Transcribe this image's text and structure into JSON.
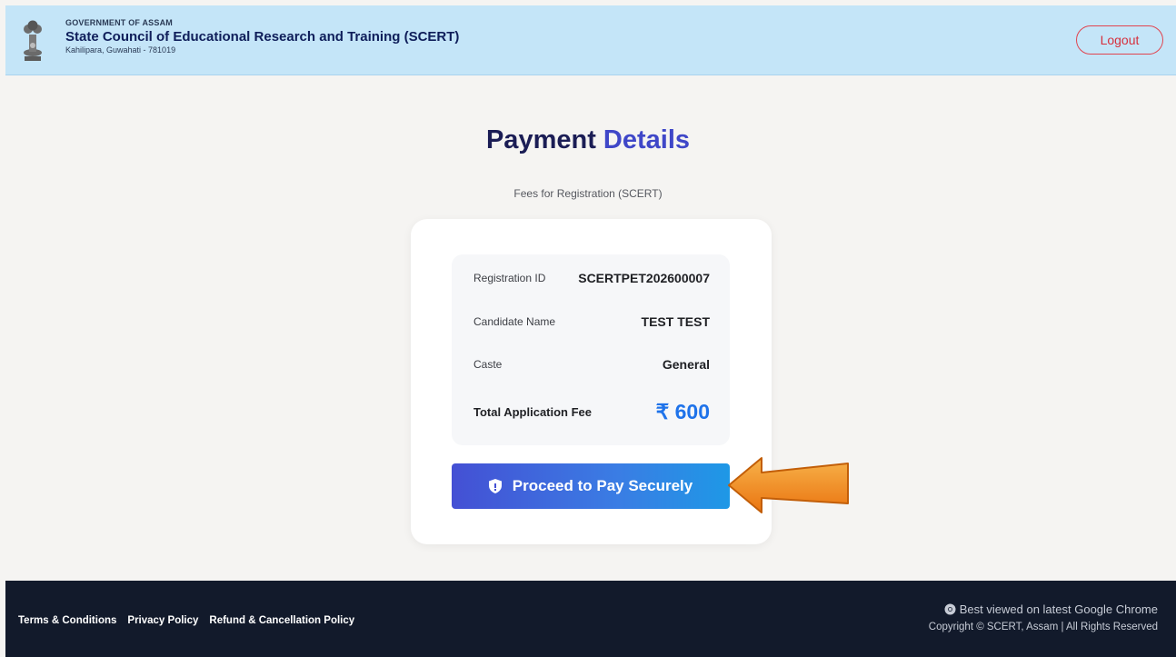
{
  "header": {
    "gov_label": "GOVERNMENT OF ASSAM",
    "org_title": "State Council of Educational Research and Training (SCERT)",
    "address": "Kahilipara, Guwahati - 781019",
    "logout_label": "Logout"
  },
  "main": {
    "title_part1": "Payment",
    "title_part2": "Details",
    "subtitle": "Fees for Registration (SCERT)"
  },
  "card": {
    "rows": [
      {
        "label": "Registration ID",
        "value": "SCERTPET202600007"
      },
      {
        "label": "Candidate Name",
        "value": "TEST TEST"
      },
      {
        "label": "Caste",
        "value": "General"
      }
    ],
    "total_label": "Total Application Fee",
    "total_value": "₹ 600",
    "pay_button_label": "Proceed to Pay Securely"
  },
  "footer": {
    "links": [
      "Terms & Conditions",
      "Privacy Policy",
      "Refund & Cancellation Policy"
    ],
    "browser_note": "Best viewed on latest Google Chrome",
    "copyright": "Copyright © SCERT, Assam | All Rights Reserved"
  },
  "colors": {
    "header_bg": "#c4e5f8",
    "title_dark": "#1b1d55",
    "title_accent": "#3f47c8",
    "fee_blue": "#1f73ea",
    "logout_red": "#e1444f",
    "footer_bg": "#121a2b",
    "arrow_orange": "#f08a1a"
  }
}
